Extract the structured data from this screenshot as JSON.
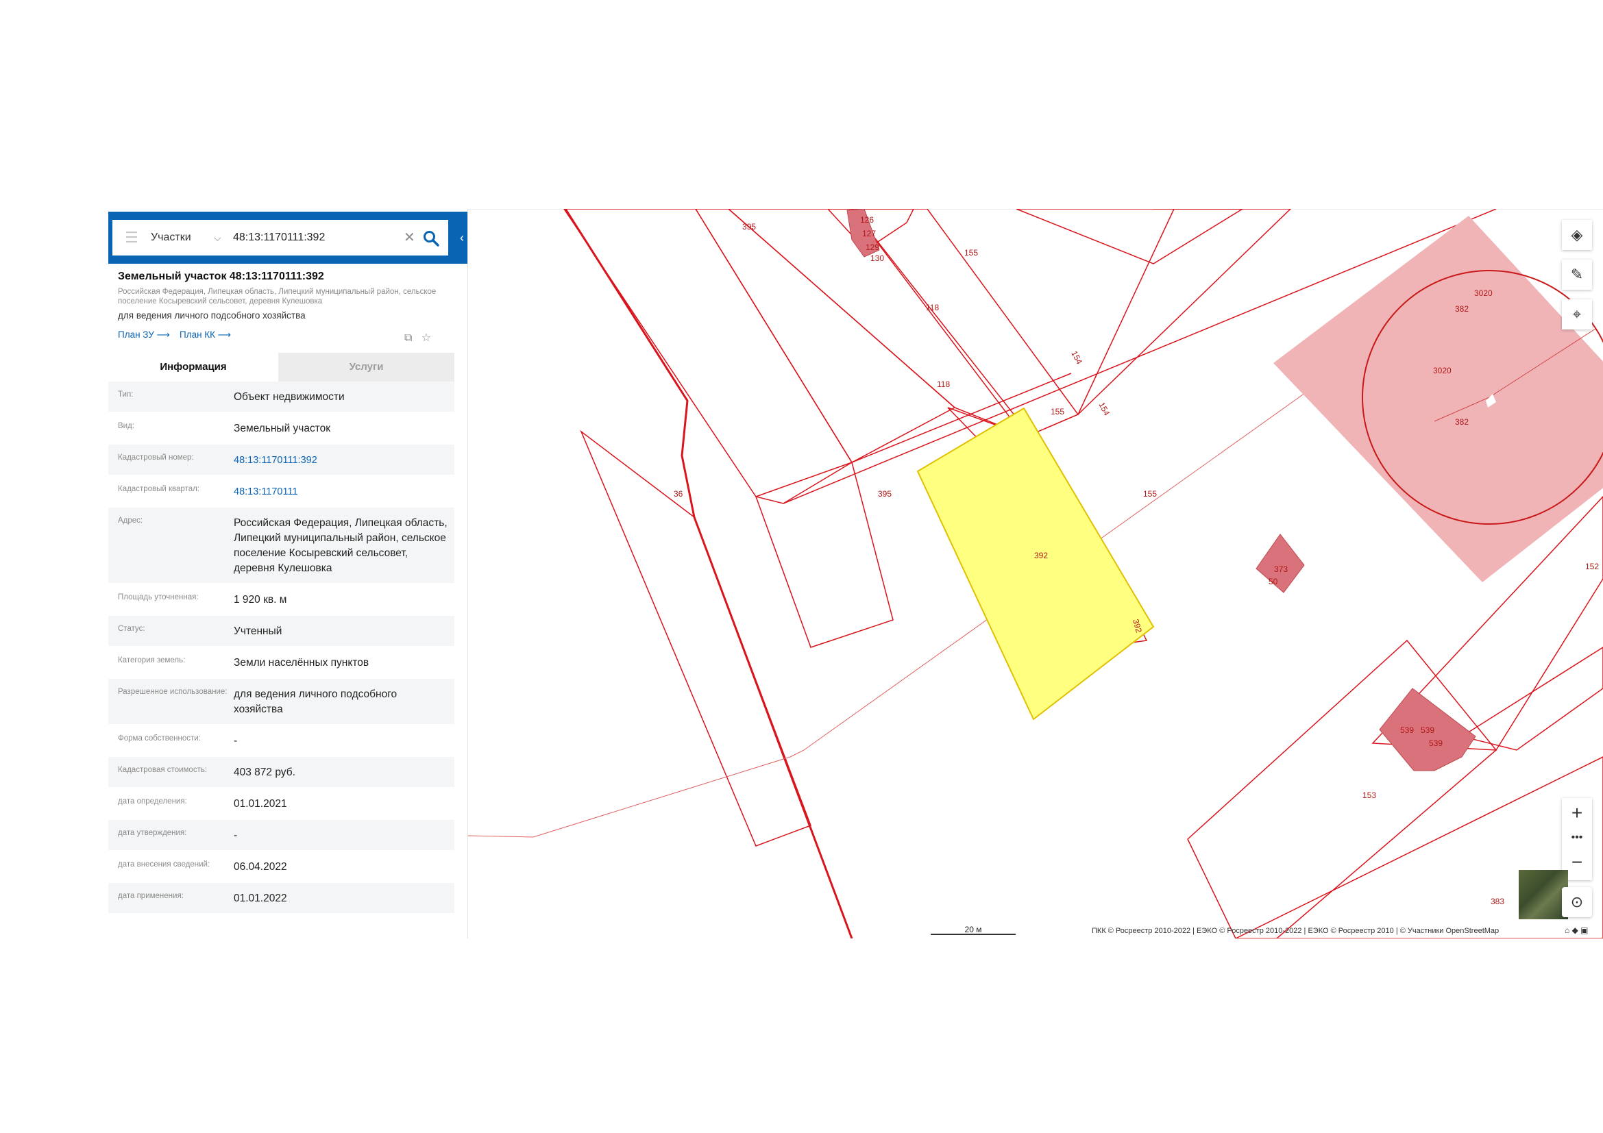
{
  "search": {
    "layer": "Участки",
    "value": "48:13:1170111:392"
  },
  "object": {
    "title": "Земельный участок 48:13:1170111:392",
    "address": "Российская Федерация, Липецкая область, Липецкий муниципальный район, сельское поселение Косыревский сельсовет, деревня Кулешовка",
    "use": "для ведения личного подсобного хозяйства",
    "plan_zu": "План ЗУ ⟶",
    "plan_kk": "План КК ⟶"
  },
  "tabs": {
    "info": "Информация",
    "services": "Услуги"
  },
  "rows": [
    {
      "label": "Тип:",
      "value": "Объект недвижимости"
    },
    {
      "label": "Вид:",
      "value": "Земельный участок"
    },
    {
      "label": "Кадастровый номер:",
      "value": "48:13:1170111:392",
      "link": true
    },
    {
      "label": "Кадастровый квартал:",
      "value": "48:13:1170111",
      "link": true
    },
    {
      "label": "Адрес:",
      "value": "Российская Федерация, Липецкая область, Липецкий муниципальный район, сельское поселение Косыревский сельсовет, деревня Кулешовка"
    },
    {
      "label": "Площадь уточненная:",
      "value": "1 920 кв. м"
    },
    {
      "label": "Статус:",
      "value": "Учтенный"
    },
    {
      "label": "Категория земель:",
      "value": "Земли населённых пунктов"
    },
    {
      "label": "Разрешенное использование:",
      "value": "для ведения личного подсобного хозяйства"
    },
    {
      "label": "Форма собственности:",
      "value": "-"
    },
    {
      "label": "Кадастровая стоимость:",
      "value": "403 872 руб."
    },
    {
      "label": "дата определения:",
      "value": "01.01.2021"
    },
    {
      "label": "дата утверждения:",
      "value": "-"
    },
    {
      "label": "дата внесения сведений:",
      "value": "06.04.2022"
    },
    {
      "label": "дата применения:",
      "value": "01.01.2022"
    }
  ],
  "map": {
    "labels": {
      "l395a": "395",
      "l126": "126",
      "l127": "127",
      "l129": "129",
      "l130": "130",
      "l155a": "155",
      "l118a": "118",
      "l118b": "118",
      "l154a": "154",
      "l154b": "154",
      "l155b": "155",
      "l3020a": "3020",
      "l382a": "382",
      "l3020b": "3020",
      "l382b": "382",
      "l36": "36",
      "l395b": "395",
      "l155c": "155",
      "l392a": "392",
      "l392b": "392",
      "l373": "373",
      "l50": "50",
      "l152": "152",
      "l539a": "539",
      "l539b": "539",
      "l539c": "539",
      "l153": "153",
      "l383": "383"
    },
    "scale": "20 м",
    "attribution": "ПКК © Росреестр 2010-2022 | ЕЭКО © Росреестр 2010-2022 | ЕЭКО © Росреестр 2010 | © Участники OpenStreetMap"
  },
  "colors": {
    "accent": "#0a64b4",
    "parcel_line": "#d9141c",
    "selected_fill": "#ffff80",
    "building_fill": "#d9727a"
  }
}
